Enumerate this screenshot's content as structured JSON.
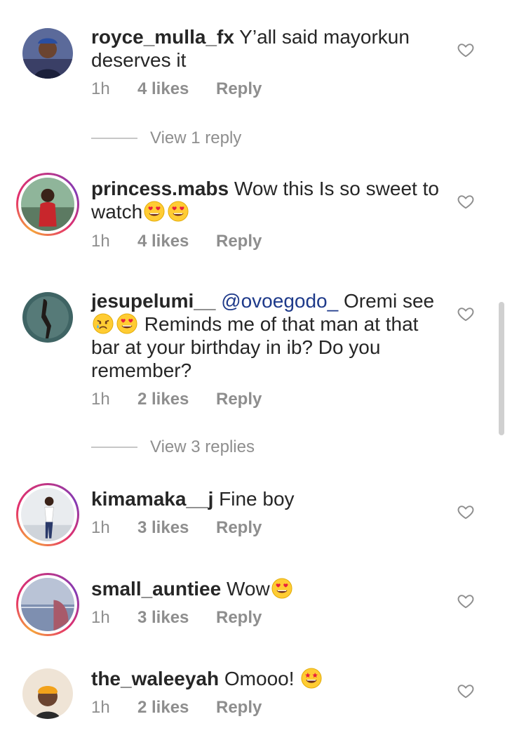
{
  "comments": [
    {
      "username": "royce_mulla_fx",
      "text": "Y’all said mayorkun deserves it",
      "time": "1h",
      "likes": "4 likes",
      "reply": "Reply",
      "view_replies": "View 1 reply"
    },
    {
      "username": "princess.mabs",
      "text": "Wow this Is so sweet to watch",
      "time": "1h",
      "likes": "4 likes",
      "reply": "Reply"
    },
    {
      "username": "jesupelumi__",
      "mention": "@ovoegodo_",
      "text_a": "Oremi see",
      "text_b": "Reminds me of that man at that bar at your birthday in ib? Do you remember?",
      "time": "1h",
      "likes": "2 likes",
      "reply": "Reply",
      "view_replies": "View 3 replies"
    },
    {
      "username": "kimamaka__j",
      "text": "Fine boy",
      "time": "1h",
      "likes": "3 likes",
      "reply": "Reply"
    },
    {
      "username": "small_auntiee",
      "text": "Wow",
      "time": "1h",
      "likes": "3 likes",
      "reply": "Reply"
    },
    {
      "username": "the_waleeyah",
      "text": "Omooo!",
      "time": "1h",
      "likes": "2 likes",
      "reply": "Reply"
    }
  ],
  "icons": {
    "like": "heart-outline-icon",
    "heart_eyes": "heart-eyes-emoji",
    "crying": "crying-face-emoji",
    "star_struck": "star-struck-emoji"
  },
  "colors": {
    "text": "#262626",
    "meta": "#8e8e8e",
    "mention": "#1e3a8a",
    "story_ring_start": "#f5a33b",
    "story_ring_end": "#c13584"
  }
}
